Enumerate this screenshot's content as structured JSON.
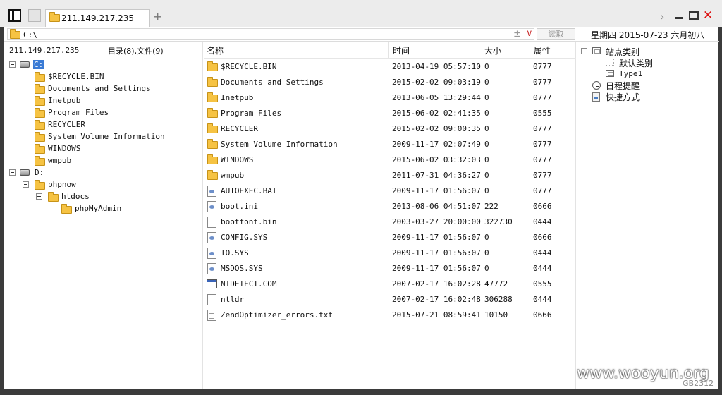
{
  "tab": {
    "title": "211.149.217.235"
  },
  "address": {
    "path": "C:\\",
    "read_button": "读取"
  },
  "date": "星期四 2015-07-23 六月初八",
  "left": {
    "host": "211.149.217.235",
    "summary": "目录(8),文件(9)",
    "tree": [
      {
        "label": "C:",
        "selected": true
      },
      {
        "label": "$RECYCLE.BIN"
      },
      {
        "label": "Documents and Settings"
      },
      {
        "label": "Inetpub"
      },
      {
        "label": "Program Files"
      },
      {
        "label": "RECYCLER"
      },
      {
        "label": "System Volume Information"
      },
      {
        "label": "WINDOWS"
      },
      {
        "label": "wmpub"
      },
      {
        "label": "D:"
      },
      {
        "label": "phpnow"
      },
      {
        "label": "htdocs"
      },
      {
        "label": "phpMyAdmin"
      }
    ]
  },
  "list": {
    "columns": {
      "name": "名称",
      "time": "时间",
      "size": "大小",
      "attr": "属性"
    },
    "rows": [
      {
        "name": "$RECYCLE.BIN",
        "time": "2013-04-19 05:57:10",
        "size": "0",
        "attr": "0777",
        "icon": "folder-icon"
      },
      {
        "name": "Documents and Settings",
        "time": "2015-02-02 09:03:19",
        "size": "0",
        "attr": "0777",
        "icon": "folder-icon"
      },
      {
        "name": "Inetpub",
        "time": "2013-06-05 13:29:44",
        "size": "0",
        "attr": "0777",
        "icon": "folder-icon"
      },
      {
        "name": "Program Files",
        "time": "2015-06-02 02:41:35",
        "size": "0",
        "attr": "0555",
        "icon": "folder-icon"
      },
      {
        "name": "RECYCLER",
        "time": "2015-02-02 09:00:35",
        "size": "0",
        "attr": "0777",
        "icon": "folder-icon"
      },
      {
        "name": "System Volume Information",
        "time": "2009-11-17 02:07:49",
        "size": "0",
        "attr": "0777",
        "icon": "folder-icon"
      },
      {
        "name": "WINDOWS",
        "time": "2015-06-02 03:32:03",
        "size": "0",
        "attr": "0777",
        "icon": "folder-icon"
      },
      {
        "name": "wmpub",
        "time": "2011-07-31 04:36:27",
        "size": "0",
        "attr": "0777",
        "icon": "folder-icon"
      },
      {
        "name": "AUTOEXEC.BAT",
        "time": "2009-11-17 01:56:07",
        "size": "0",
        "attr": "0777",
        "icon": "system-file-icon"
      },
      {
        "name": "boot.ini",
        "time": "2013-08-06 04:51:07",
        "size": "222",
        "attr": "0666",
        "icon": "system-file-icon"
      },
      {
        "name": "bootfont.bin",
        "time": "2003-03-27 20:00:00",
        "size": "322730",
        "attr": "0444",
        "icon": "file-icon"
      },
      {
        "name": "CONFIG.SYS",
        "time": "2009-11-17 01:56:07",
        "size": "0",
        "attr": "0666",
        "icon": "system-file-icon"
      },
      {
        "name": "IO.SYS",
        "time": "2009-11-17 01:56:07",
        "size": "0",
        "attr": "0444",
        "icon": "system-file-icon"
      },
      {
        "name": "MSDOS.SYS",
        "time": "2009-11-17 01:56:07",
        "size": "0",
        "attr": "0444",
        "icon": "system-file-icon"
      },
      {
        "name": "NTDETECT.COM",
        "time": "2007-02-17 16:02:28",
        "size": "47772",
        "attr": "0555",
        "icon": "executable-icon"
      },
      {
        "name": "ntldr",
        "time": "2007-02-17 16:02:48",
        "size": "306288",
        "attr": "0444",
        "icon": "file-icon"
      },
      {
        "name": "ZendOptimizer_errors.txt",
        "time": "2015-07-21 08:59:41",
        "size": "10150",
        "attr": "0666",
        "icon": "text-file-icon"
      }
    ]
  },
  "right": {
    "site_category": "站点类别",
    "default_category": "默认类别",
    "type1": "Type1",
    "schedule": "日程提醒",
    "shortcut": "快捷方式"
  },
  "watermark": {
    "site": "www.wooyun.org",
    "encoding": "GB2312"
  }
}
